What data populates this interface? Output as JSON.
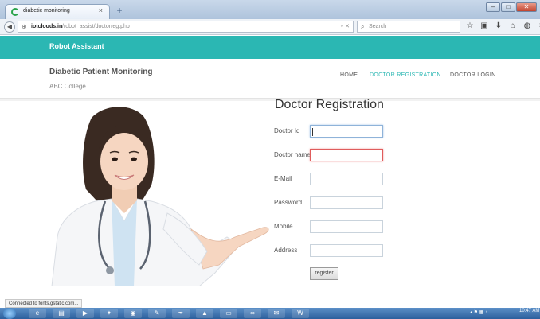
{
  "browser": {
    "tab_title": "diabetic monitoring",
    "tab_close": "×",
    "new_tab": "+",
    "url_host": "iotclouds.in",
    "url_path": "/robot_assist/doctorreg.php",
    "url_actions": "▿ ✕",
    "search_placeholder": "Search",
    "status_text": "Connected to fonts.gstatic.com..."
  },
  "site": {
    "brand": "Robot Assistant",
    "title": "Diabetic Patient Monitoring",
    "subtitle": "ABC College",
    "accent_color": "#2bb7b3",
    "nav": [
      "HOME",
      "DOCTOR REGISTRATION",
      "DOCTOR LOGIN"
    ]
  },
  "form": {
    "heading": "Doctor Registration",
    "fields": [
      {
        "label": "Doctor Id",
        "value": ""
      },
      {
        "label": "Doctor name",
        "value": ""
      },
      {
        "label": "E-Mail",
        "value": ""
      },
      {
        "label": "Password",
        "value": ""
      },
      {
        "label": "Mobile",
        "value": ""
      },
      {
        "label": "Address",
        "value": ""
      }
    ],
    "submit_label": "register"
  },
  "taskbar": {
    "clock_time": "10:47 AM"
  },
  "icons": [
    "globe-icon",
    "search-icon",
    "star-icon",
    "clipboard-icon",
    "download-icon",
    "home-icon",
    "menu-icon"
  ]
}
